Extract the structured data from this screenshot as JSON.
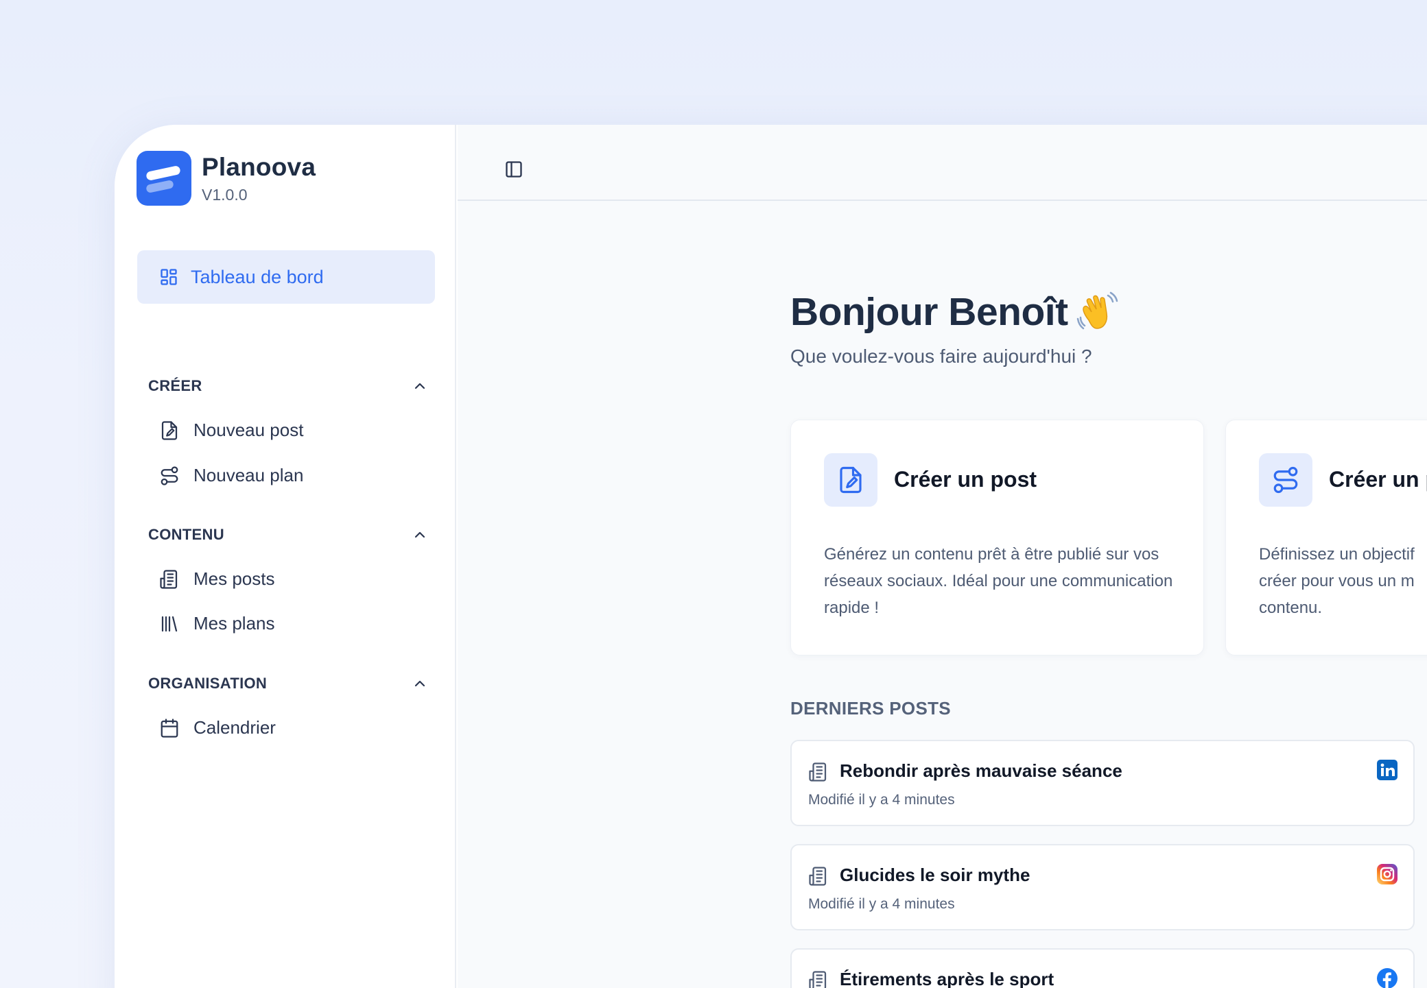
{
  "app": {
    "name": "Planoova",
    "version": "V1.0.0"
  },
  "sidebar": {
    "active_item": {
      "label": "Tableau de bord",
      "icon": "dashboard-icon"
    },
    "sections": [
      {
        "title": "CRÉER",
        "items": [
          {
            "label": "Nouveau post",
            "icon": "file-edit-icon"
          },
          {
            "label": "Nouveau plan",
            "icon": "route-icon"
          }
        ]
      },
      {
        "title": "CONTENU",
        "items": [
          {
            "label": "Mes posts",
            "icon": "newspaper-icon"
          },
          {
            "label": "Mes plans",
            "icon": "library-icon"
          }
        ]
      },
      {
        "title": "ORGANISATION",
        "items": [
          {
            "label": "Calendrier",
            "icon": "calendar-icon"
          }
        ]
      }
    ]
  },
  "main": {
    "greeting": "Bonjour Benoît",
    "subtitle": "Que voulez-vous faire aujourd'hui ?",
    "cards": [
      {
        "title": "Créer un post",
        "description": "Générez un contenu prêt à être publié sur vos réseaux sociaux. Idéal pour une communication rapide !",
        "icon": "file-edit-icon"
      },
      {
        "title": "Créer un p",
        "description": "Définissez un objectif créer pour vous un m contenu.",
        "icon": "route-icon"
      }
    ],
    "recent_label": "DERNIERS POSTS",
    "posts": [
      {
        "title": "Rebondir après mauvaise séance",
        "meta": "Modifié il y a 4 minutes",
        "network": "linkedin"
      },
      {
        "title": "Glucides le soir mythe",
        "meta": "Modifié il y a 4 minutes",
        "network": "instagram"
      },
      {
        "title": "Étirements après le sport",
        "meta": "",
        "network": "facebook"
      }
    ]
  },
  "colors": {
    "accent": "#2f6bf0",
    "active_bg": "#e7edfc",
    "linkedin": "#0a66c2",
    "facebook": "#1877f2"
  }
}
